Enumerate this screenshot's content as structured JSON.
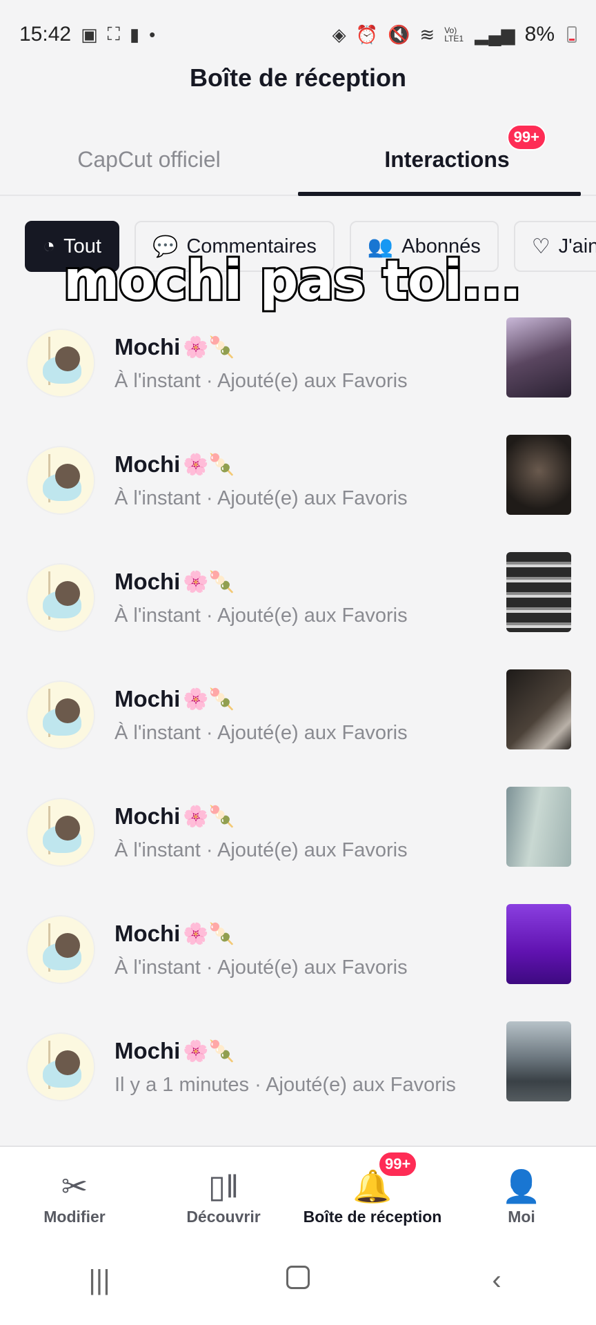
{
  "status_bar": {
    "time": "15:42",
    "battery": "8%",
    "icons_left": [
      "image-icon",
      "screenshot-icon",
      "battery-alert-icon",
      "dot-icon"
    ],
    "icons_right": [
      "android-icon",
      "alarm-icon",
      "mute-icon",
      "wifi-icon",
      "lte-icon",
      "signal-icon"
    ],
    "lte_label": "Vo) LTE1"
  },
  "header": {
    "title": "Boîte de réception"
  },
  "top_tabs": [
    {
      "label": "CapCut officiel",
      "active": false
    },
    {
      "label": "Interactions",
      "active": true,
      "badge": "99+"
    }
  ],
  "chips": [
    {
      "label": "Tout",
      "icon": "activity-icon",
      "active": true
    },
    {
      "label": "Commentaires",
      "icon": "comment-icon",
      "active": false
    },
    {
      "label": "Abonnés",
      "icon": "users-icon",
      "active": false
    },
    {
      "label": "J'ain",
      "icon": "heart-icon",
      "active": false
    }
  ],
  "overlay_caption": "mochi pas toi...",
  "list": [
    {
      "name": "Mochi",
      "emoji": "🌸🍡",
      "subtitle": "À l'instant · Ajouté(e) aux Favoris",
      "thumb_color": "#5a4660"
    },
    {
      "name": "Mochi",
      "emoji": "🌸🍡",
      "subtitle": "À l'instant · Ajouté(e) aux Favoris",
      "thumb_color": "#2c2723"
    },
    {
      "name": "Mochi",
      "emoji": "🌸🍡",
      "subtitle": "À l'instant · Ajouté(e) aux Favoris",
      "thumb_color": "#3a3a3a"
    },
    {
      "name": "Mochi",
      "emoji": "🌸🍡",
      "subtitle": "À l'instant · Ajouté(e) aux Favoris",
      "thumb_color": "#2f2a26"
    },
    {
      "name": "Mochi",
      "emoji": "🌸🍡",
      "subtitle": "À l'instant · Ajouté(e) aux Favoris",
      "thumb_color": "#a9c1c2"
    },
    {
      "name": "Mochi",
      "emoji": "🌸🍡",
      "subtitle": "À l'instant · Ajouté(e) aux Favoris",
      "thumb_color": "#6d1fb3"
    },
    {
      "name": "Mochi",
      "emoji": "🌸🍡",
      "subtitle": "Il y a 1 minutes · Ajouté(e) aux Favoris",
      "thumb_color": "#55606a"
    }
  ],
  "bottom_nav": [
    {
      "label": "Modifier",
      "icon": "scissors-icon",
      "active": false
    },
    {
      "label": "Découvrir",
      "icon": "discover-icon",
      "active": false
    },
    {
      "label": "Boîte de réception",
      "icon": "bell-icon",
      "active": true,
      "badge": "99+"
    },
    {
      "label": "Moi",
      "icon": "profile-icon",
      "active": false
    }
  ],
  "colors": {
    "accent": "#fe2c55",
    "text": "#161823",
    "muted": "#8a8b91"
  }
}
